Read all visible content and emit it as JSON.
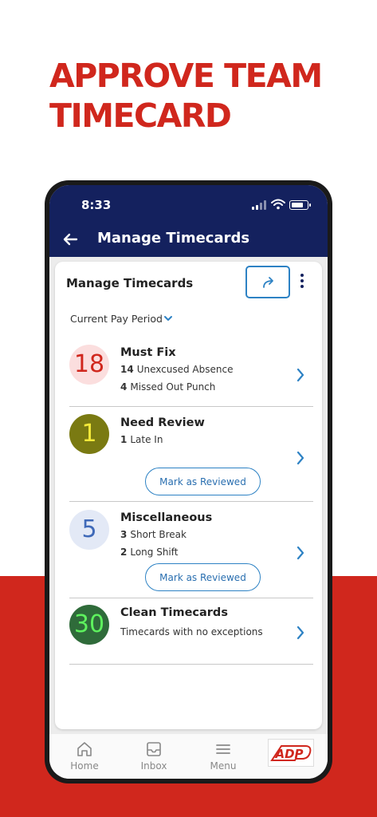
{
  "headline": {
    "line1": "APPROVE TEAM",
    "line2": "TIMECARD"
  },
  "status_bar": {
    "time": "8:33"
  },
  "app_bar": {
    "title": "Manage Timecards"
  },
  "card": {
    "title": "Manage Timecards",
    "period_label": "Current Pay Period"
  },
  "sections": [
    {
      "count": "18",
      "title": "Must Fix",
      "lines": [
        {
          "n": "14",
          "text": "Unexcused Absence"
        },
        {
          "n": "4",
          "text": "Missed Out Punch"
        }
      ]
    },
    {
      "count": "1",
      "title": "Need Review",
      "lines": [
        {
          "n": "1",
          "text": "Late In"
        }
      ],
      "button": "Mark as Reviewed"
    },
    {
      "count": "5",
      "title": "Miscellaneous",
      "lines": [
        {
          "n": "3",
          "text": "Short Break"
        },
        {
          "n": "2",
          "text": "Long Shift"
        }
      ],
      "button": "Mark as Reviewed"
    },
    {
      "count": "30",
      "title": "Clean Timecards",
      "lines": [
        {
          "text": "Timecards with no exceptions"
        }
      ]
    }
  ],
  "tabs": [
    {
      "label": "Home",
      "icon": "home-icon"
    },
    {
      "label": "Inbox",
      "icon": "inbox-icon"
    },
    {
      "label": "Menu",
      "icon": "menu-icon"
    }
  ],
  "brand": {
    "logo_text": "ADP"
  },
  "colors": {
    "brand_red": "#d0271d",
    "navy": "#14215e",
    "accent_blue": "#2d82c4",
    "must_fix_bg": "#fbdede",
    "must_fix_fg": "#d0271d",
    "need_review_bg": "#7a7a12",
    "need_review_fg": "#f5ea3a",
    "misc_bg": "#e3e9f6",
    "misc_fg": "#3f69b8",
    "clean_bg": "#2f6b3a",
    "clean_fg": "#5ef25e"
  }
}
